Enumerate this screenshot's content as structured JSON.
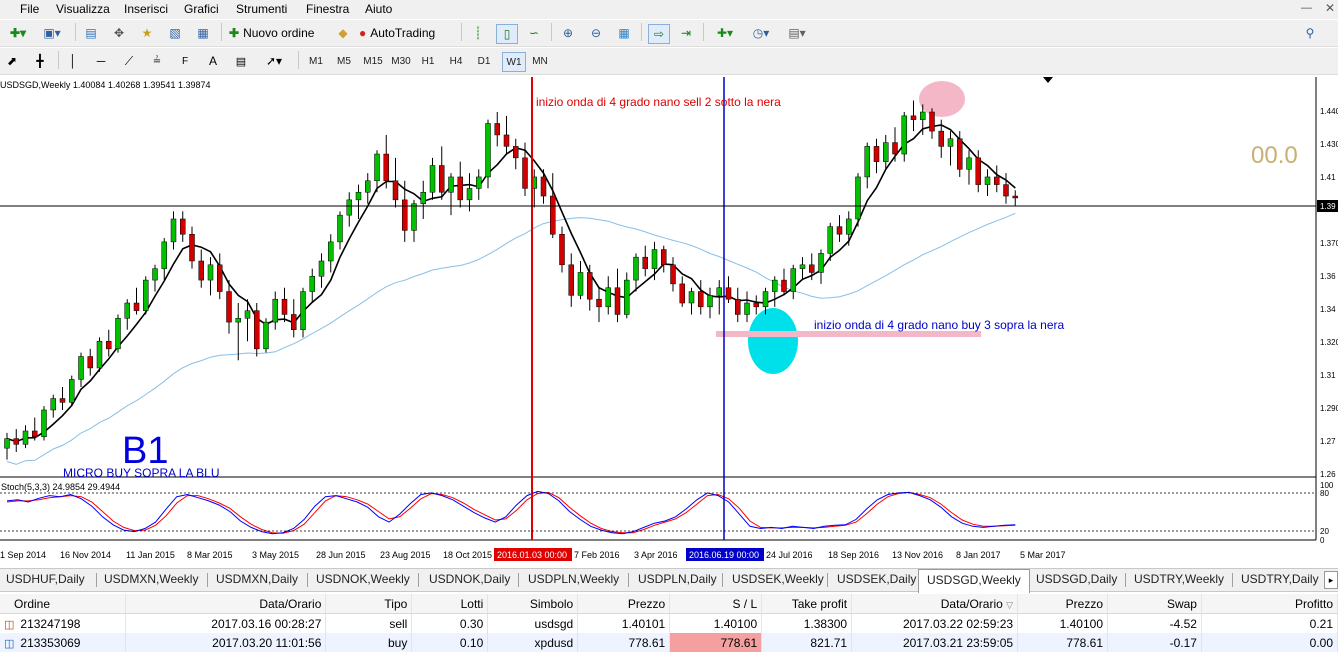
{
  "menu": [
    "File",
    "Visualizza",
    "Inserisci",
    "Grafici",
    "Strumenti",
    "Finestra",
    "Aiuto"
  ],
  "toolbar": {
    "new_order": "Nuovo ordine",
    "autotrading": "AutoTrading"
  },
  "timeframes": [
    "M1",
    "M5",
    "M15",
    "M30",
    "H1",
    "H4",
    "D1",
    "W1",
    "MN"
  ],
  "active_timeframe": "W1",
  "chart_header": "USDSGD,Weekly  1.40084 1.40268 1.39541 1.39874",
  "stoch_header": "Stoch(5,3,3) 24.9854 29.4944",
  "annotations": {
    "sell_text": "inizio onda di 4 grado nano sell 2 sotto la nera",
    "buy_text": "inizio onda di 4 grado nano buy 3 sopra la nera",
    "b1_text": "B1",
    "micro_text": "MICRO BUY SOPRA LA BLU",
    "big_value": "00.0"
  },
  "price_axis": [
    "1.440",
    "1.430",
    "1.41",
    "1.39",
    "1.370",
    "1.36",
    "1.34",
    "1.320",
    "1.31",
    "1.290",
    "1.27",
    "1.26"
  ],
  "stoch_axis": [
    "100",
    "80",
    "20",
    "0"
  ],
  "date_axis": [
    "1 Sep 2014",
    "16 Nov 2014",
    "11 Jan 2015",
    "8 Mar 2015",
    "3 May 2015",
    "28 Jun 2015",
    "23 Aug 2015",
    "18 Oct 2015",
    "7 Feb 2016",
    "3 Apr 2016",
    "24 Jul 2016",
    "18 Sep 2016",
    "13 Nov 2016",
    "8 Jan 2017",
    "5 Mar 2017"
  ],
  "date_markers": {
    "red": "2016.01.03 00:00",
    "blue": "2016.06.19 00:00"
  },
  "tabs": [
    "USDHUF,Daily",
    "USDMXN,Weekly",
    "USDMXN,Daily",
    "USDNOK,Weekly",
    "USDNOK,Daily",
    "USDPLN,Weekly",
    "USDPLN,Daily",
    "USDSEK,Weekly",
    "USDSEK,Daily",
    "USDSGD,Weekly",
    "USDSGD,Daily",
    "USDTRY,Weekly",
    "USDTRY,Daily"
  ],
  "active_tab": "USDSGD,Weekly",
  "orders": {
    "headers": [
      "Ordine",
      "Data/Orario",
      "Tipo",
      "Lotti",
      "Simbolo",
      "Prezzo",
      "S / L",
      "Take profit",
      "Data/Orario",
      "Prezzo",
      "Swap",
      "Profitto"
    ],
    "rows": [
      {
        "id": "213247198",
        "open_time": "2017.03.16 00:28:27",
        "type": "sell",
        "lots": "0.30",
        "symbol": "usdsgd",
        "price": "1.40101",
        "sl": "1.40100",
        "tp": "1.38300",
        "close_time": "2017.03.22 02:59:23",
        "close_price": "1.40100",
        "swap": "-4.52",
        "profit": "0.21"
      },
      {
        "id": "213353069",
        "open_time": "2017.03.20 11:01:56",
        "type": "buy",
        "lots": "0.10",
        "symbol": "xpdusd",
        "price": "778.61",
        "sl": "778.61",
        "tp": "821.71",
        "close_time": "2017.03.21 23:59:05",
        "close_price": "778.61",
        "swap": "-0.17",
        "profit": "0.00"
      }
    ]
  },
  "colors": {
    "bull": "#00c000",
    "bear": "#d00000",
    "ma_fast": "#000000",
    "ma_slow": "#87bfe8",
    "sell_line": "#e00000",
    "buy_line": "#0000c8",
    "stoch_main": "#0000ff",
    "stoch_signal": "#ff0000"
  },
  "chart_data": {
    "type": "candlestick",
    "symbol": "USDSGD",
    "timeframe": "Weekly",
    "ylim": [
      1.255,
      1.455
    ],
    "ohlc": [
      [
        1.268,
        1.276,
        1.262,
        1.273
      ],
      [
        1.273,
        1.278,
        1.266,
        1.27
      ],
      [
        1.27,
        1.28,
        1.268,
        1.277
      ],
      [
        1.277,
        1.284,
        1.272,
        1.274
      ],
      [
        1.274,
        1.29,
        1.272,
        1.288
      ],
      [
        1.288,
        1.296,
        1.284,
        1.294
      ],
      [
        1.294,
        1.3,
        1.288,
        1.292
      ],
      [
        1.292,
        1.306,
        1.29,
        1.304
      ],
      [
        1.304,
        1.318,
        1.3,
        1.316
      ],
      [
        1.316,
        1.32,
        1.306,
        1.31
      ],
      [
        1.31,
        1.326,
        1.308,
        1.324
      ],
      [
        1.324,
        1.33,
        1.316,
        1.32
      ],
      [
        1.32,
        1.338,
        1.318,
        1.336
      ],
      [
        1.336,
        1.346,
        1.33,
        1.344
      ],
      [
        1.344,
        1.352,
        1.338,
        1.34
      ],
      [
        1.34,
        1.358,
        1.338,
        1.356
      ],
      [
        1.356,
        1.364,
        1.35,
        1.362
      ],
      [
        1.362,
        1.378,
        1.356,
        1.376
      ],
      [
        1.376,
        1.392,
        1.372,
        1.388
      ],
      [
        1.388,
        1.392,
        1.376,
        1.38
      ],
      [
        1.38,
        1.384,
        1.362,
        1.366
      ],
      [
        1.366,
        1.372,
        1.352,
        1.356
      ],
      [
        1.356,
        1.368,
        1.348,
        1.364
      ],
      [
        1.364,
        1.37,
        1.346,
        1.35
      ],
      [
        1.35,
        1.356,
        1.328,
        1.334
      ],
      [
        1.334,
        1.344,
        1.314,
        1.336
      ],
      [
        1.336,
        1.346,
        1.324,
        1.34
      ],
      [
        1.34,
        1.344,
        1.316,
        1.32
      ],
      [
        1.32,
        1.336,
        1.318,
        1.334
      ],
      [
        1.334,
        1.35,
        1.33,
        1.346
      ],
      [
        1.346,
        1.352,
        1.334,
        1.338
      ],
      [
        1.338,
        1.346,
        1.326,
        1.33
      ],
      [
        1.33,
        1.352,
        1.326,
        1.35
      ],
      [
        1.35,
        1.362,
        1.344,
        1.358
      ],
      [
        1.358,
        1.37,
        1.352,
        1.366
      ],
      [
        1.366,
        1.38,
        1.36,
        1.376
      ],
      [
        1.376,
        1.392,
        1.372,
        1.39
      ],
      [
        1.39,
        1.402,
        1.384,
        1.398
      ],
      [
        1.398,
        1.406,
        1.388,
        1.402
      ],
      [
        1.402,
        1.412,
        1.396,
        1.408
      ],
      [
        1.408,
        1.424,
        1.402,
        1.422
      ],
      [
        1.422,
        1.432,
        1.404,
        1.408
      ],
      [
        1.408,
        1.42,
        1.394,
        1.398
      ],
      [
        1.398,
        1.408,
        1.376,
        1.382
      ],
      [
        1.382,
        1.398,
        1.376,
        1.396
      ],
      [
        1.396,
        1.408,
        1.388,
        1.402
      ],
      [
        1.402,
        1.42,
        1.398,
        1.416
      ],
      [
        1.416,
        1.426,
        1.398,
        1.402
      ],
      [
        1.402,
        1.412,
        1.39,
        1.41
      ],
      [
        1.41,
        1.418,
        1.394,
        1.398
      ],
      [
        1.398,
        1.412,
        1.392,
        1.404
      ],
      [
        1.404,
        1.414,
        1.398,
        1.41
      ],
      [
        1.41,
        1.44,
        1.404,
        1.438
      ],
      [
        1.438,
        1.444,
        1.426,
        1.432
      ],
      [
        1.432,
        1.442,
        1.422,
        1.426
      ],
      [
        1.426,
        1.43,
        1.414,
        1.42
      ],
      [
        1.42,
        1.428,
        1.4,
        1.404
      ],
      [
        1.404,
        1.414,
        1.394,
        1.41
      ],
      [
        1.41,
        1.414,
        1.396,
        1.4
      ],
      [
        1.4,
        1.412,
        1.378,
        1.38
      ],
      [
        1.38,
        1.384,
        1.36,
        1.364
      ],
      [
        1.364,
        1.37,
        1.342,
        1.348
      ],
      [
        1.348,
        1.366,
        1.346,
        1.36
      ],
      [
        1.36,
        1.364,
        1.34,
        1.346
      ],
      [
        1.346,
        1.352,
        1.334,
        1.342
      ],
      [
        1.342,
        1.358,
        1.338,
        1.352
      ],
      [
        1.352,
        1.362,
        1.334,
        1.338
      ],
      [
        1.338,
        1.36,
        1.336,
        1.356
      ],
      [
        1.356,
        1.37,
        1.35,
        1.368
      ],
      [
        1.368,
        1.374,
        1.358,
        1.362
      ],
      [
        1.362,
        1.376,
        1.356,
        1.372
      ],
      [
        1.372,
        1.374,
        1.36,
        1.364
      ],
      [
        1.364,
        1.368,
        1.35,
        1.354
      ],
      [
        1.354,
        1.358,
        1.342,
        1.344
      ],
      [
        1.344,
        1.352,
        1.338,
        1.35
      ],
      [
        1.35,
        1.356,
        1.338,
        1.342
      ],
      [
        1.342,
        1.352,
        1.336,
        1.348
      ],
      [
        1.348,
        1.356,
        1.338,
        1.352
      ],
      [
        1.352,
        1.358,
        1.344,
        1.346
      ],
      [
        1.346,
        1.352,
        1.334,
        1.338
      ],
      [
        1.338,
        1.35,
        1.334,
        1.344
      ],
      [
        1.344,
        1.348,
        1.338,
        1.342
      ],
      [
        1.342,
        1.352,
        1.338,
        1.35
      ],
      [
        1.35,
        1.358,
        1.342,
        1.356
      ],
      [
        1.356,
        1.362,
        1.348,
        1.35
      ],
      [
        1.35,
        1.364,
        1.346,
        1.362
      ],
      [
        1.362,
        1.368,
        1.356,
        1.364
      ],
      [
        1.364,
        1.37,
        1.356,
        1.36
      ],
      [
        1.36,
        1.372,
        1.354,
        1.37
      ],
      [
        1.37,
        1.386,
        1.366,
        1.384
      ],
      [
        1.384,
        1.39,
        1.376,
        1.38
      ],
      [
        1.38,
        1.392,
        1.374,
        1.388
      ],
      [
        1.388,
        1.412,
        1.384,
        1.41
      ],
      [
        1.41,
        1.428,
        1.404,
        1.426
      ],
      [
        1.426,
        1.43,
        1.412,
        1.418
      ],
      [
        1.418,
        1.432,
        1.414,
        1.428
      ],
      [
        1.428,
        1.436,
        1.418,
        1.422
      ],
      [
        1.422,
        1.444,
        1.418,
        1.442
      ],
      [
        1.442,
        1.45,
        1.434,
        1.44
      ],
      [
        1.44,
        1.448,
        1.432,
        1.444
      ],
      [
        1.444,
        1.446,
        1.43,
        1.434
      ],
      [
        1.434,
        1.44,
        1.42,
        1.426
      ],
      [
        1.426,
        1.434,
        1.416,
        1.43
      ],
      [
        1.43,
        1.434,
        1.41,
        1.414
      ],
      [
        1.414,
        1.424,
        1.406,
        1.42
      ],
      [
        1.42,
        1.424,
        1.402,
        1.406
      ],
      [
        1.406,
        1.414,
        1.4,
        1.41
      ],
      [
        1.41,
        1.416,
        1.402,
        1.406
      ],
      [
        1.406,
        1.412,
        1.396,
        1.4
      ],
      [
        1.4,
        1.403,
        1.395,
        1.399
      ]
    ],
    "stoch_main": [
      70,
      72,
      68,
      75,
      80,
      78,
      82,
      74,
      60,
      40,
      25,
      15,
      12,
      18,
      30,
      55,
      78,
      82,
      76,
      70,
      62,
      50,
      32,
      20,
      12,
      8,
      10,
      18,
      35,
      60,
      78,
      80,
      74,
      68,
      58,
      40,
      30,
      45,
      65,
      82,
      85,
      80,
      72,
      60,
      48,
      38,
      30,
      40,
      62,
      80,
      88,
      84,
      70,
      50,
      35,
      22,
      15,
      10,
      8,
      12,
      20,
      28,
      32,
      40,
      55,
      72,
      85,
      80,
      68,
      45,
      22,
      18,
      20,
      18,
      22,
      20,
      18,
      22,
      24,
      25,
      35,
      55,
      72,
      82,
      85,
      86,
      80,
      72,
      58,
      40,
      28,
      22,
      20,
      22,
      24,
      25
    ],
    "stoch_signal": [
      68,
      70,
      70,
      72,
      76,
      78,
      80,
      78,
      68,
      50,
      32,
      20,
      14,
      15,
      24,
      42,
      66,
      80,
      80,
      74,
      66,
      56,
      40,
      26,
      16,
      10,
      9,
      14,
      26,
      48,
      70,
      80,
      78,
      72,
      64,
      50,
      36,
      40,
      56,
      74,
      84,
      82,
      76,
      66,
      54,
      44,
      34,
      36,
      52,
      72,
      84,
      86,
      76,
      58,
      42,
      28,
      18,
      12,
      10,
      10,
      16,
      24,
      30,
      36,
      48,
      64,
      80,
      82,
      74,
      56,
      32,
      20,
      19,
      19,
      20,
      20,
      19,
      20,
      22,
      24,
      30,
      46,
      64,
      78,
      84,
      86,
      82,
      76,
      64,
      48,
      34,
      26,
      22,
      22,
      23,
      24
    ]
  }
}
